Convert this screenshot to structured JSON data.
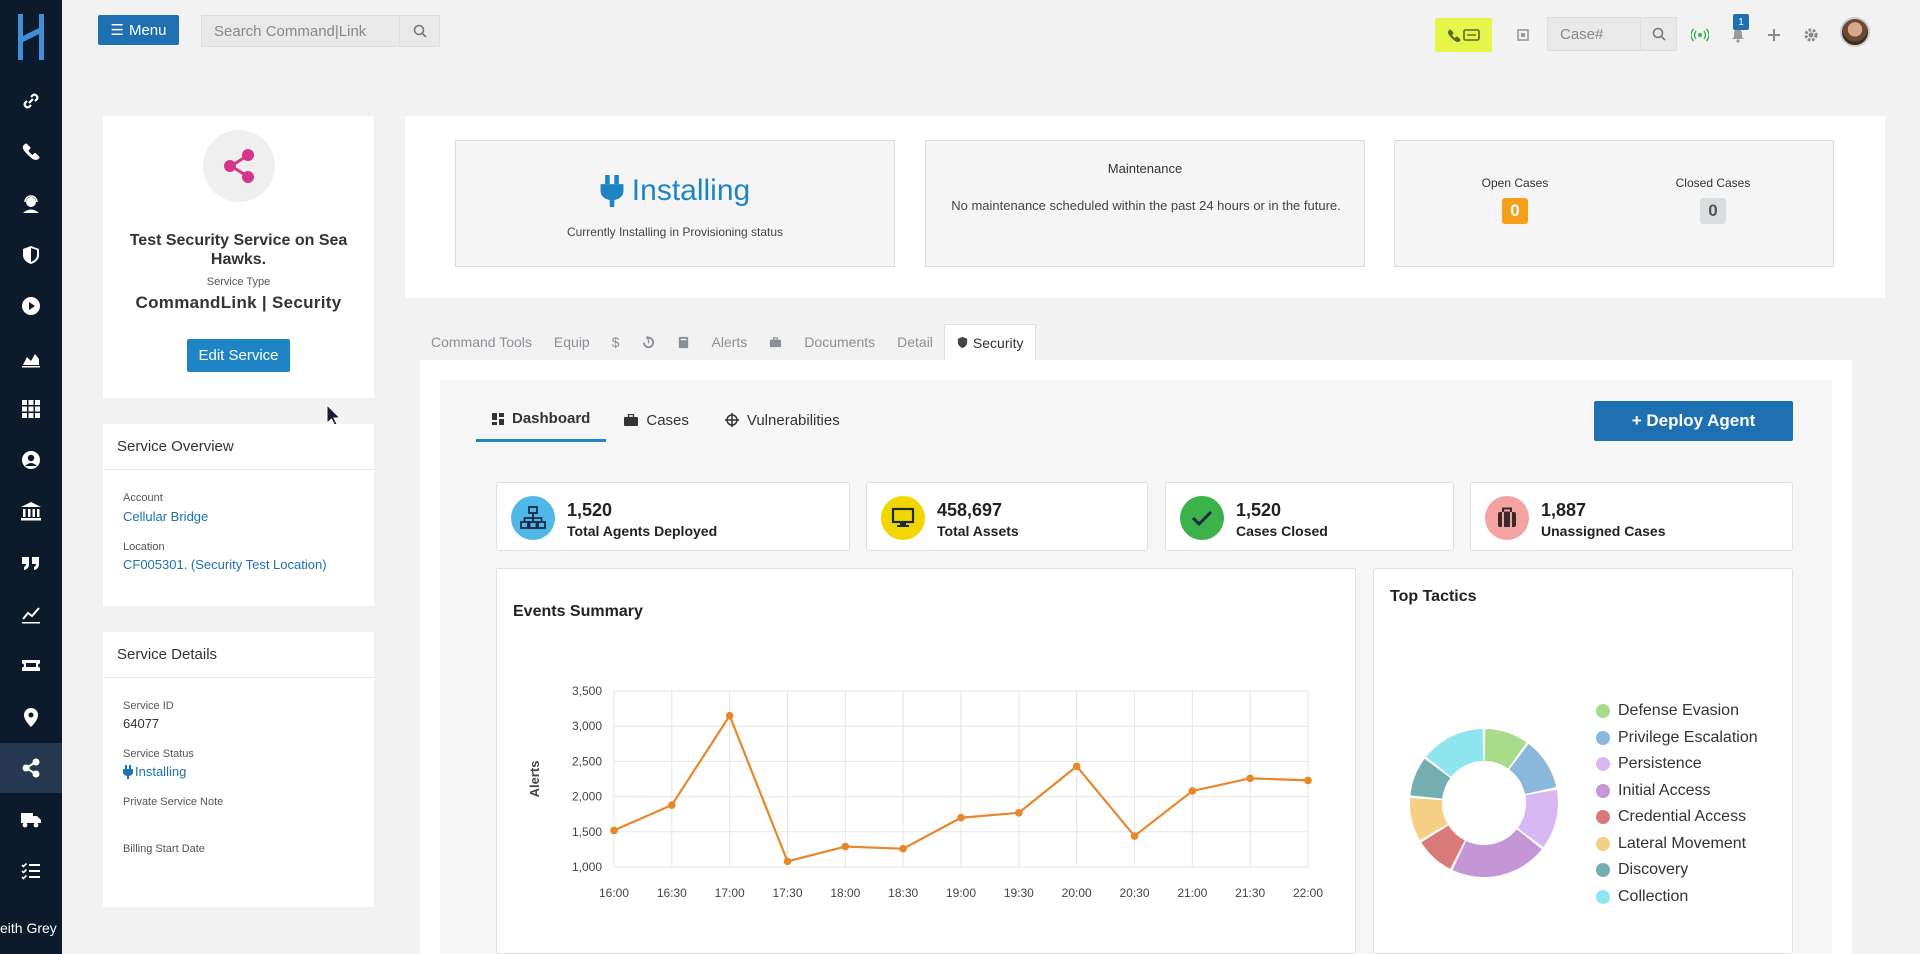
{
  "rail": {
    "items": [
      "link-icon",
      "phone-icon",
      "support-agent-icon",
      "shield-icon",
      "play-icon",
      "area-chart-icon",
      "grid-icon",
      "user-icon",
      "bank-icon",
      "quote-icon",
      "line-chart-icon",
      "ticket-icon",
      "location-pin-icon",
      "share-icon",
      "truck-icon",
      "checklist-icon"
    ],
    "active_index": 13,
    "user_name": "eith Grey"
  },
  "topbar": {
    "menu_label": "Menu",
    "search_placeholder": "Search Command|Link",
    "case_placeholder": "Case#",
    "notification_count": "1",
    "phone_badge_color": "#e6f54a"
  },
  "service": {
    "title": "Test Security Service on Sea Hawks.",
    "type_label": "Service Type",
    "type": "CommandLink | Security",
    "edit_label": "Edit Service"
  },
  "overview": {
    "heading": "Service Overview",
    "account_label": "Account",
    "account": "Cellular Bridge",
    "location_label": "Location",
    "location": "CF005301. (Security Test Location)"
  },
  "details": {
    "heading": "Service Details",
    "id_label": "Service ID",
    "id": "64077",
    "status_label": "Service Status",
    "status": "Installing",
    "note_label": "Private Service Note",
    "billing_label": "Billing Start Date"
  },
  "status_cards": {
    "installing_title": "Installing",
    "installing_sub": "Currently Installing in Provisioning status",
    "maintenance_title": "Maintenance",
    "maintenance_text": "No maintenance scheduled within the past 24 hours or in the future.",
    "open_cases_label": "Open Cases",
    "open_cases": "0",
    "closed_cases_label": "Closed Cases",
    "closed_cases": "0"
  },
  "tabs": {
    "command_tools": "Command Tools",
    "equip": "Equip",
    "alerts": "Alerts",
    "documents": "Documents",
    "detail": "Detail",
    "security": "Security"
  },
  "subtabs": {
    "dashboard": "Dashboard",
    "cases": "Cases",
    "vulnerabilities": "Vulnerabilities",
    "deploy": "+ Deploy Agent"
  },
  "kpis": [
    {
      "value": "1,520",
      "label": "Total Agents Deployed",
      "color": "#4fb8e8",
      "icon": "network-icon"
    },
    {
      "value": "458,697",
      "label": "Total Assets",
      "color": "#f2d600",
      "icon": "monitor-icon"
    },
    {
      "value": "1,520",
      "label": "Cases Closed",
      "color": "#3cb34a",
      "icon": "check-icon"
    },
    {
      "value": "1,887",
      "label": "Unassigned Cases",
      "color": "#f4a3a3",
      "icon": "briefcase-icon"
    }
  ],
  "events_card_title": "Events Summary",
  "tactics_card_title": "Top Tactics",
  "chart_data": [
    {
      "type": "line",
      "title": "Events Summary",
      "xlabel": "",
      "ylabel": "Alerts",
      "x": [
        "16:00",
        "16:30",
        "17:00",
        "17:30",
        "18:00",
        "18:30",
        "19:00",
        "19:30",
        "20:00",
        "20:30",
        "21:00",
        "21:30",
        "22:00"
      ],
      "values": [
        1520,
        1880,
        3150,
        1080,
        1290,
        1260,
        1700,
        1770,
        2430,
        1440,
        2080,
        2260,
        2230
      ],
      "ylim": [
        1000,
        3500
      ],
      "yticks": [
        "1,000",
        "1,500",
        "2,000",
        "2,500",
        "3,000",
        "3,500"
      ],
      "grid": true,
      "color": "#e8862a"
    },
    {
      "type": "pie",
      "title": "Top Tactics",
      "legend": "right",
      "slices": [
        {
          "label": "Defense Evasion",
          "value": 11,
          "color": "#a8dc8a"
        },
        {
          "label": "Privilege Escalation",
          "value": 13,
          "color": "#8ab8dc"
        },
        {
          "label": "Persistence",
          "value": 15,
          "color": "#d8b8f2"
        },
        {
          "label": "Initial Access",
          "value": 24,
          "color": "#c496d6"
        },
        {
          "label": "Credential Access",
          "value": 10,
          "color": "#d87a7a"
        },
        {
          "label": "Lateral Movement",
          "value": 11,
          "color": "#f5cf85"
        },
        {
          "label": "Discovery",
          "value": 10,
          "color": "#74aeb0"
        },
        {
          "label": "Collection",
          "value": 16,
          "color": "#8ee6f0"
        }
      ]
    }
  ]
}
